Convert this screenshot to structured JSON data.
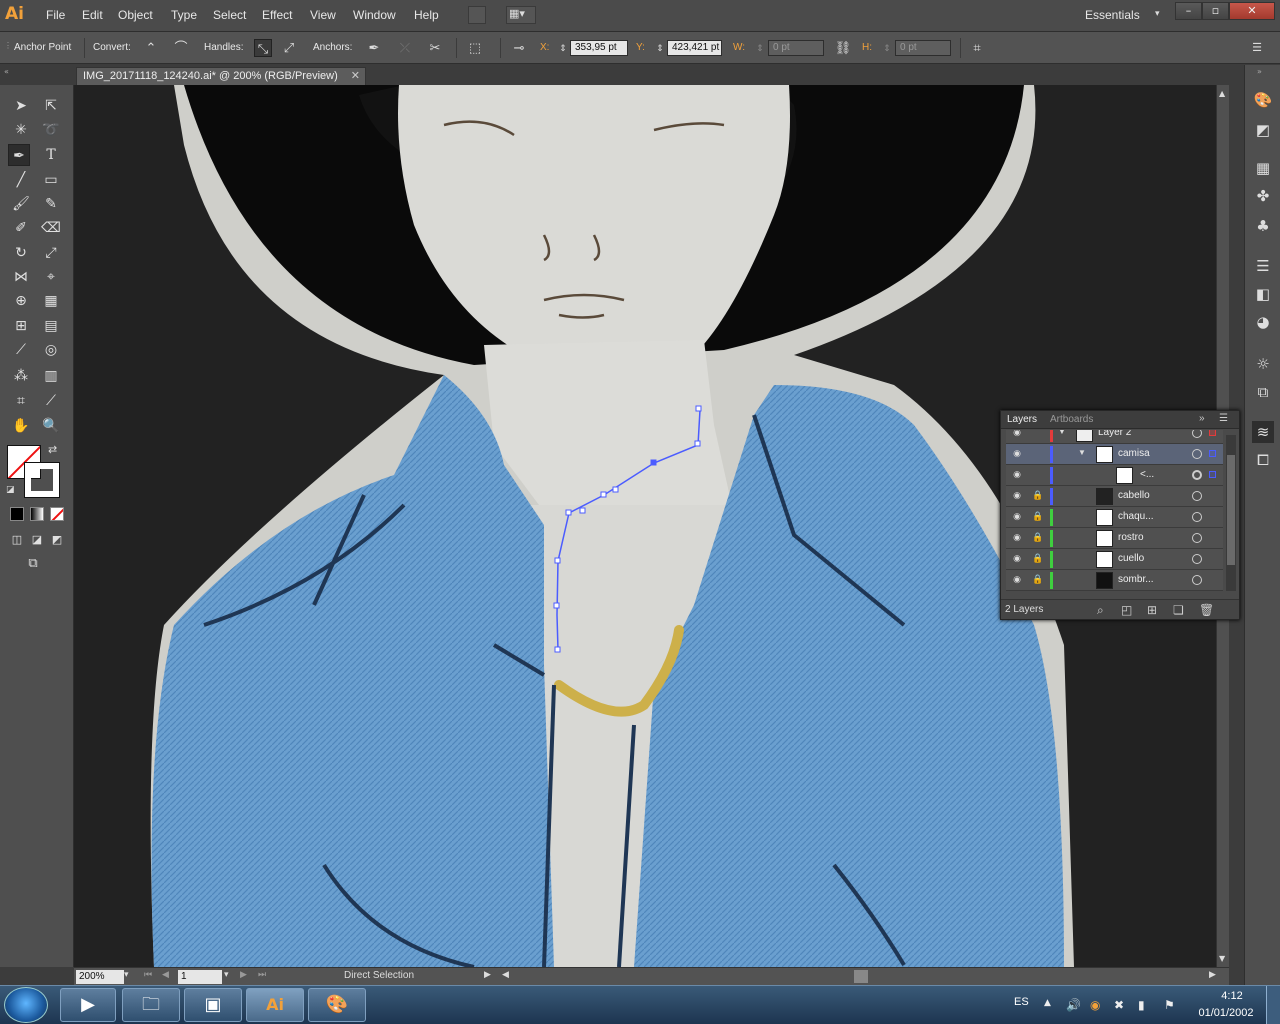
{
  "app": {
    "logo": "Ai"
  },
  "menu": [
    "File",
    "Edit",
    "Object",
    "Type",
    "Select",
    "Effect",
    "View",
    "Window",
    "Help"
  ],
  "workspace": "Essentials",
  "window_controls": {
    "minimize": "–",
    "restore": "▫",
    "close": "✕"
  },
  "control_bar": {
    "mode_label": "Anchor Point",
    "convert_label": "Convert:",
    "handles_label": "Handles:",
    "anchors_label": "Anchors:",
    "x_label": "X:",
    "x_value": "353,95 pt",
    "y_label": "Y:",
    "y_value": "423,421 pt",
    "w_label": "W:",
    "w_value": "0 pt",
    "h_label": "H:",
    "h_value": "0 pt"
  },
  "document_tab": {
    "title": "IMG_20171118_124240.ai* @ 200% (RGB/Preview)",
    "close": "✕"
  },
  "status_bar": {
    "zoom": "200%",
    "page": "1",
    "tool": "Direct Selection"
  },
  "layers_panel": {
    "tabs": [
      "Layers",
      "Artboards"
    ],
    "rows": [
      {
        "name": "Layer 2",
        "color": "#e33b3b",
        "indent": 0
      },
      {
        "name": "camisa",
        "color": "#4b5cff",
        "indent": 1
      },
      {
        "name": "<...",
        "color": "#4b5cff",
        "indent": 2
      },
      {
        "name": "cabello",
        "color": "#4b5cff",
        "indent": 1
      },
      {
        "name": "chaqu...",
        "color": "#3fcf3f",
        "indent": 1
      },
      {
        "name": "rostro",
        "color": "#3fcf3f",
        "indent": 1
      },
      {
        "name": "cuello",
        "color": "#3fcf3f",
        "indent": 1
      },
      {
        "name": "sombr...",
        "color": "#3fcf3f",
        "indent": 1
      }
    ],
    "count": "2 Layers"
  },
  "taskbar": {
    "language": "ES",
    "time": "4:12",
    "date": "01/01/2002"
  },
  "colors": {
    "accent": "#f2a13a",
    "path": "#4b5cff",
    "denim": "#5b93c7"
  }
}
